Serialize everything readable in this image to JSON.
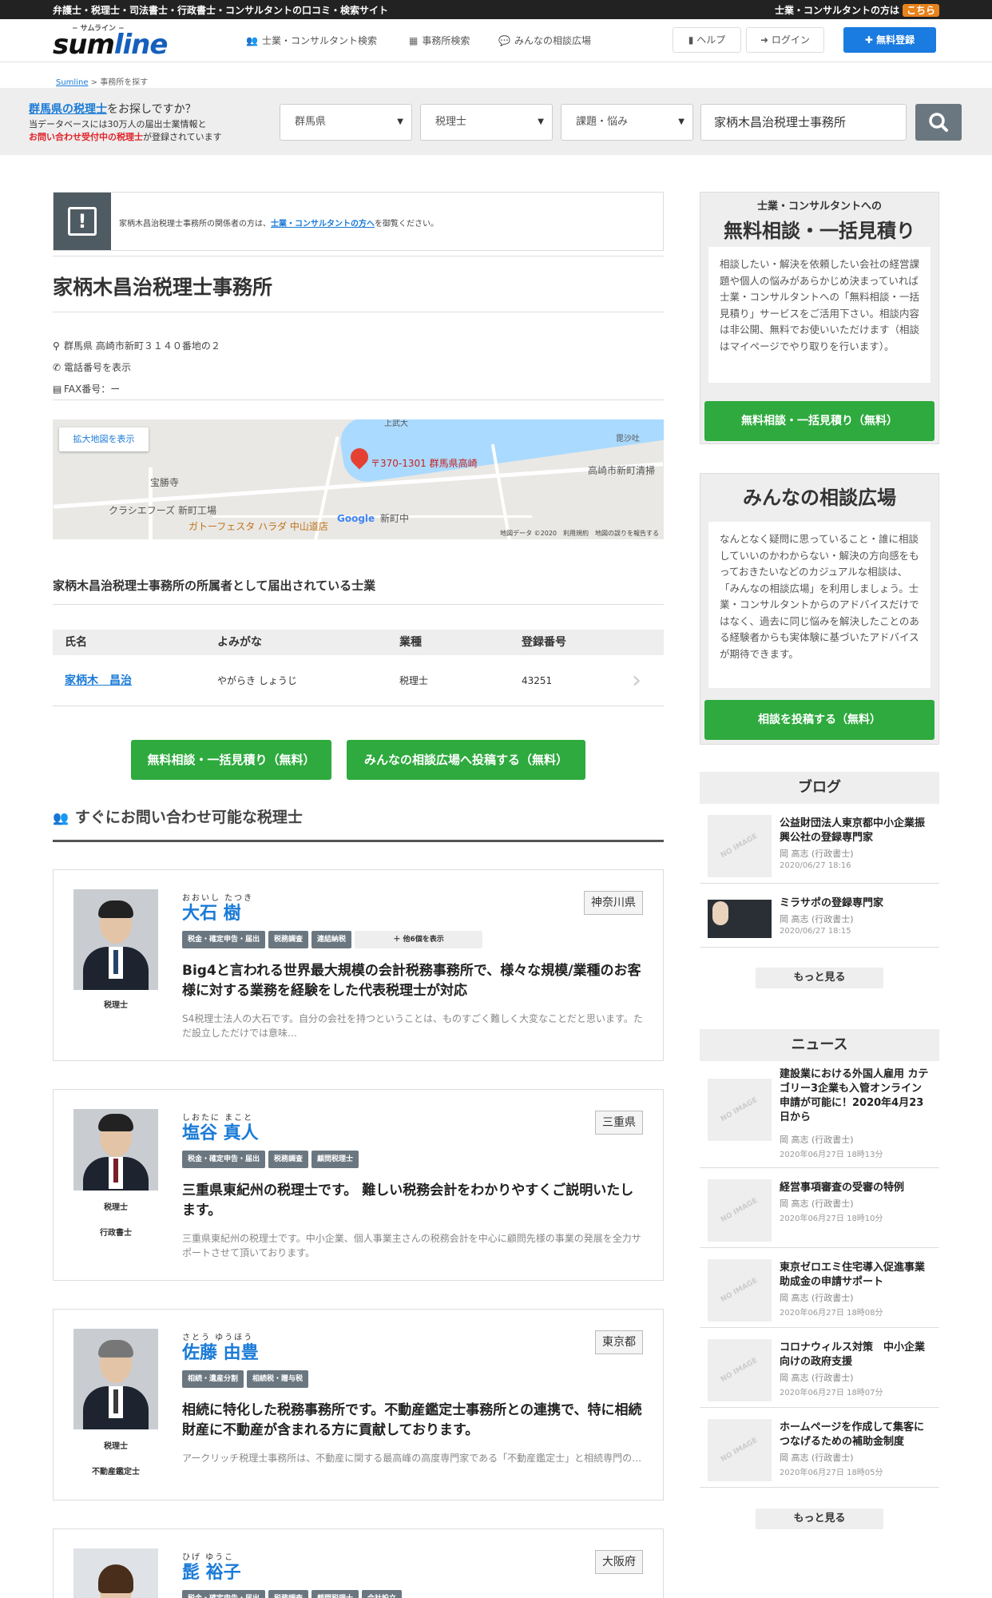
{
  "topbar": {
    "tagline": "弁護士・税理士・司法書士・行政書士・コンサルタントの口コミ・検索サイト",
    "pro_prefix": "士業・コンサルタントの方は",
    "pro_link": "こちら"
  },
  "header": {
    "logo_sub": "− サムライン −",
    "logo_main_a": "sum",
    "logo_main_b": "line",
    "nav": [
      {
        "icon": "users-icon",
        "label": "士業・コンサルタント検索"
      },
      {
        "icon": "building-icon",
        "label": "事務所検索"
      },
      {
        "icon": "comments-icon",
        "label": "みんなの相談広場"
      }
    ],
    "help": "ヘルプ",
    "login": "ログイン",
    "register": "無料登録"
  },
  "breadcrumb": {
    "home": "Sumline",
    "sep": ">",
    "current": "事務所を探す"
  },
  "search": {
    "q_link": "群馬県の税理士",
    "q_rest": "をお探しですか？",
    "db_line1": "当データベースには30万人の届出士業情報と",
    "db_line2_bold": "お問い合わせ受付中の税理士",
    "db_line2_rest": "が登録されています",
    "pref": "群馬県",
    "job": "税理士",
    "topic": "課題・悩み",
    "keyword": "家柄木昌治税理士事務所"
  },
  "notice": {
    "pre": "家柄木昌治税理士事務所の関係者の方は、",
    "link": "士業・コンサルタントの方へ",
    "post": "を御覧ください。"
  },
  "office": {
    "name": "家柄木昌治税理士事務所",
    "address": "群馬県 高崎市新町３１４０番地の２",
    "phone": "電話番号を表示",
    "fax": "FAX番号：ー"
  },
  "map": {
    "enlarge": "拡大地図を表示",
    "pin_label": "〒370-1301 群馬県高崎",
    "places": [
      "宝勝寺",
      "クラシエフーズ 新町工場",
      "ガトーフェスタ ハラダ 中山道店",
      "新町中",
      "高崎市新町清掃",
      "毘沙吐",
      "上武大"
    ],
    "google": "Google",
    "credit": "地図データ ©2020　利用規約　地図の誤りを報告する"
  },
  "members": {
    "heading": "家柄木昌治税理士事務所の所属者として届出されている士業",
    "columns": [
      "氏名",
      "よみがな",
      "業種",
      "登録番号"
    ],
    "rows": [
      {
        "name": "家柄木　昌治",
        "kana": "やがらき しょうじ",
        "job": "税理士",
        "reg": "43251"
      }
    ]
  },
  "cta": {
    "consult": "無料相談・一括見積り（無料）",
    "forum": "みんなの相談広場へ投稿する（無料）"
  },
  "advisors": {
    "heading": "すぐにお問い合わせ可能な税理士",
    "items": [
      {
        "furigana": "おおいし たつき",
        "name": "大石 樹",
        "pref": "神奈川県",
        "roles": [
          "税理士"
        ],
        "tags": [
          "税金・確定申告・届出",
          "税務調査",
          "連結納税",
          "＋ 他6個を表示"
        ],
        "headline": "Big4と言われる世界最大規模の会計税務事務所で、様々な規模/業種のお客様に対する業務を経験をした代表税理士が対応",
        "desc": "S4税理士法人の大石です。自分の会社を持つということは、ものすごく難しく大変なことだと思います。ただ設立しただけでは意味…"
      },
      {
        "furigana": "しおたに まこと",
        "name": "塩谷 真人",
        "pref": "三重県",
        "roles": [
          "税理士",
          "行政書士"
        ],
        "tags": [
          "税金・確定申告・届出",
          "税務調査",
          "顧問税理士"
        ],
        "headline": "三重県東紀州の税理士です。 難しい税務会計をわかりやすくご説明いたします。",
        "desc": "三重県東紀州の税理士です。中小企業、個人事業主さんの税務会計を中心に顧問先様の事業の発展を全力サポートさせて頂いております。"
      },
      {
        "furigana": "さとう ゆうほう",
        "name": "佐藤 由豊",
        "pref": "東京都",
        "roles": [
          "税理士",
          "不動産鑑定士"
        ],
        "tags": [
          "相続・遺産分割",
          "相続税・贈与税"
        ],
        "headline": "相続に特化した税務事務所です。不動産鑑定士事務所との連携で、特に相続財産に不動産が含まれる方に貢献しております。",
        "desc": "アークリッチ税理士事務所は、不動産に関する最高峰の高度専門家である「不動産鑑定士」と相続専門の…"
      },
      {
        "furigana": "ひげ ゆうこ",
        "name": "髭 裕子",
        "pref": "大阪府",
        "roles": [],
        "tags": [
          "税金・確定申告・届出",
          "税務調査",
          "顧問税理士",
          "会社設立"
        ],
        "headline": "",
        "desc": ""
      }
    ]
  },
  "sidebar": {
    "consult": {
      "small": "士業・コンサルタントへの",
      "big": "無料相談・一括見積り",
      "body": "相談したい・解決を依頼したい会社の経営課題や個人の悩みがあらかじめ決まっていれば士業・コンサルタントへの「無料相談・一括見積り」サービスをご活用下さい。相談内容は非公開、無料でお使いいただけます（相談はマイページでやり取りを行います）。",
      "button": "無料相談・一括見積り（無料）"
    },
    "forum": {
      "big": "みんなの相談広場",
      "body": "なんとなく疑問に思っていること・誰に相談していいのかわからない・解決の方向感をもっておきたいなどのカジュアルな相談は、「みんなの相談広場」を利用しましょう。士業・コンサルタントからのアドバイスだけではなく、過去に同じ悩みを解決したことのある経験者からも実体験に基づいたアドバイスが期待できます。",
      "button": "相談を投稿する（無料）"
    },
    "blog": {
      "heading": "ブログ",
      "items": [
        {
          "title": "公益財団法人東京都中小企業振興公社の登録専門家",
          "author": "岡 高志 (行政書士)",
          "date": "2020/06/27 18:16",
          "thumb": "NO IMAGE"
        },
        {
          "title": "ミラサポの登録専門家",
          "author": "岡 高志 (行政書士)",
          "date": "2020/06/27 18:15",
          "thumb": ""
        }
      ],
      "more": "もっと見る"
    },
    "news": {
      "heading": "ニュース",
      "items": [
        {
          "title": "建設業における外国人雇用 カテゴリー3企業も入管オンライン申請が可能に！2020年4月23日から",
          "author": "岡 高志 (行政書士)",
          "date": "2020年06月27日 18時13分",
          "thumb": "NO IMAGE"
        },
        {
          "title": "経営事項審査の受審の特例",
          "author": "岡 高志 (行政書士)",
          "date": "2020年06月27日 18時10分",
          "thumb": "NO IMAGE"
        },
        {
          "title": "東京ゼロエミ住宅導入促進事業　助成金の申請サポート",
          "author": "岡 高志 (行政書士)",
          "date": "2020年06月27日 18時08分",
          "thumb": "NO IMAGE"
        },
        {
          "title": "コロナウィルス対策　中小企業向けの政府支援",
          "author": "岡 高志 (行政書士)",
          "date": "2020年06月27日 18時07分",
          "thumb": "NO IMAGE"
        },
        {
          "title": "ホームページを作成して集客につなげるための補助金制度",
          "author": "岡 高志 (行政書士)",
          "date": "2020年06月27日 18時05分",
          "thumb": "NO IMAGE"
        }
      ],
      "more": "もっと見る"
    }
  }
}
